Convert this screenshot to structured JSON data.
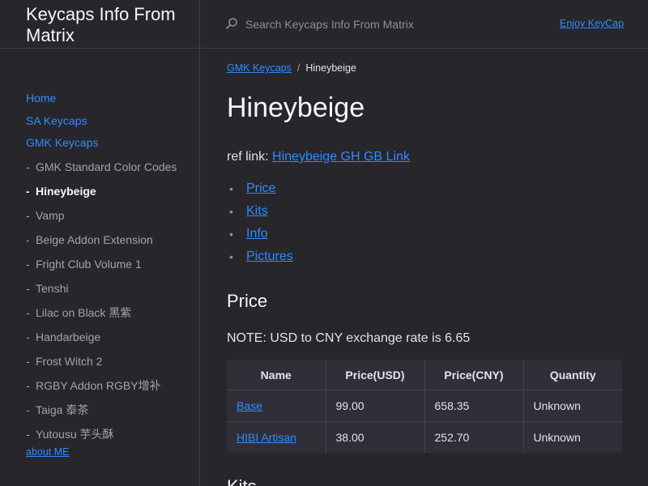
{
  "site": {
    "title": "Keycaps Info From Matrix"
  },
  "header": {
    "search_placeholder": "Search Keycaps Info From Matrix",
    "aux_link": "Enjoy KeyCap"
  },
  "sidebar": {
    "items": [
      {
        "label": "Home"
      },
      {
        "label": "SA Keycaps"
      },
      {
        "label": "GMK Keycaps"
      }
    ],
    "sub_items": [
      {
        "label": "GMK Standard Color Codes",
        "active": false
      },
      {
        "label": "Hineybeige",
        "active": true
      },
      {
        "label": "Vamp",
        "active": false
      },
      {
        "label": "Beige Addon Extension",
        "active": false
      },
      {
        "label": "Fright Club Volume 1",
        "active": false
      },
      {
        "label": "Tenshi",
        "active": false
      },
      {
        "label": "Lilac on Black 黑紫",
        "active": false
      },
      {
        "label": "Handarbeige",
        "active": false
      },
      {
        "label": "Frost Witch 2",
        "active": false
      },
      {
        "label": "RGBY Addon RGBY增补",
        "active": false
      },
      {
        "label": "Taiga 泰茶",
        "active": false
      },
      {
        "label": "Yutousu 芋头酥",
        "active": false
      }
    ],
    "bullet": "-",
    "about_link": "about ME"
  },
  "breadcrumb": {
    "parent": "GMK Keycaps",
    "separator": "/",
    "current": "Hineybeige"
  },
  "page": {
    "title": "Hineybeige",
    "ref_label": "ref link:",
    "ref_link": "Hineybeige GH GB Link",
    "toc_bullet": "•",
    "toc": [
      "Price",
      "Kits",
      "Info",
      "Pictures"
    ]
  },
  "price": {
    "heading": "Price",
    "note": "NOTE: USD to CNY exchange rate is 6.65",
    "headers": [
      "Name",
      "Price(USD)",
      "Price(CNY)",
      "Quantity"
    ],
    "rows": [
      [
        "Base",
        "99.00",
        "658.35",
        "Unknown"
      ],
      [
        "HIBI Artisan",
        "38.00",
        "252.70",
        "Unknown"
      ]
    ]
  },
  "kits": {
    "heading": "Kits"
  },
  "colors": {
    "background": "#27262b",
    "link": "#2f8cff",
    "border": "#44434d"
  }
}
